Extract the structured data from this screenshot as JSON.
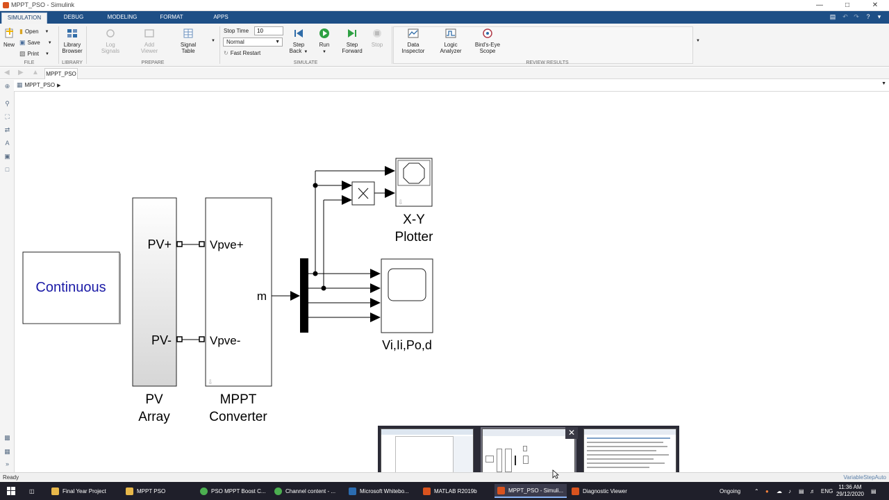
{
  "window": {
    "title": "MPPT_PSO - Simulink"
  },
  "tabs": [
    "SIMULATION",
    "DEBUG",
    "MODELING",
    "FORMAT",
    "APPS"
  ],
  "ribbon": {
    "file": {
      "new": "New",
      "open": "Open",
      "save": "Save",
      "print": "Print",
      "section": "FILE"
    },
    "library": {
      "browser_line1": "Library",
      "browser_line2": "Browser",
      "section": "LIBRARY"
    },
    "prepare": {
      "log_signals_1": "Log",
      "log_signals_2": "Signals",
      "add_viewer_1": "Add",
      "add_viewer_2": "Viewer",
      "signal_table_1": "Signal",
      "signal_table_2": "Table",
      "section": "PREPARE"
    },
    "simulate": {
      "stop_time_label": "Stop Time",
      "stop_time_value": "10",
      "mode": "Normal",
      "fast_restart": "Fast Restart",
      "step_back_1": "Step",
      "step_back_2": "Back",
      "run": "Run",
      "step_forward_1": "Step",
      "step_forward_2": "Forward",
      "stop": "Stop",
      "section": "SIMULATE"
    },
    "review": {
      "data_inspector_1": "Data",
      "data_inspector_2": "Inspector",
      "logic_analyzer_1": "Logic",
      "logic_analyzer_2": "Analyzer",
      "birds_eye_1": "Bird's-Eye",
      "birds_eye_2": "Scope",
      "section": "REVIEW RESULTS"
    }
  },
  "doc_tab": "MPPT_PSO",
  "breadcrumb": "MPPT_PSO",
  "model": {
    "continuous": "Continuous",
    "pv_port_plus": "PV+",
    "pv_port_minus": "PV-",
    "pv_name_1": "PV",
    "pv_name_2": "Array",
    "conv_port_plus": "Vpve+",
    "conv_port_minus": "Vpve-",
    "conv_port_m": "m",
    "conv_name_1": "MPPT",
    "conv_name_2": "Converter",
    "xy_name_1": "X-Y",
    "xy_name_2": "Plotter",
    "scope_name": "Vi,Ii,Po,d"
  },
  "status": {
    "left": "Ready",
    "right": "VariableStepAuto"
  },
  "taskbar": {
    "items": [
      {
        "label": "Final Year Project",
        "color": "#e8b84a"
      },
      {
        "label": "MPPT PSO",
        "color": "#e8b84a"
      },
      {
        "label": "PSO MPPT Boost C...",
        "color": "#4caf50"
      },
      {
        "label": "Channel content - ...",
        "color": "#4caf50"
      },
      {
        "label": "Microsoft Whitebo...",
        "color": "#2b6cb0"
      },
      {
        "label": "MATLAB R2019b",
        "color": "#d9531e"
      },
      {
        "label": "MPPT_PSO - Simuli...",
        "color": "#d9531e"
      },
      {
        "label": "Diagnostic Viewer",
        "color": "#d9531e"
      }
    ],
    "ongoing": "Ongoing",
    "lang": "ENG",
    "time": "11:36 AM",
    "date": "29/12/2020"
  },
  "colors": {
    "accent": "#1e4f86",
    "continuous_text": "#1a1aa6"
  }
}
